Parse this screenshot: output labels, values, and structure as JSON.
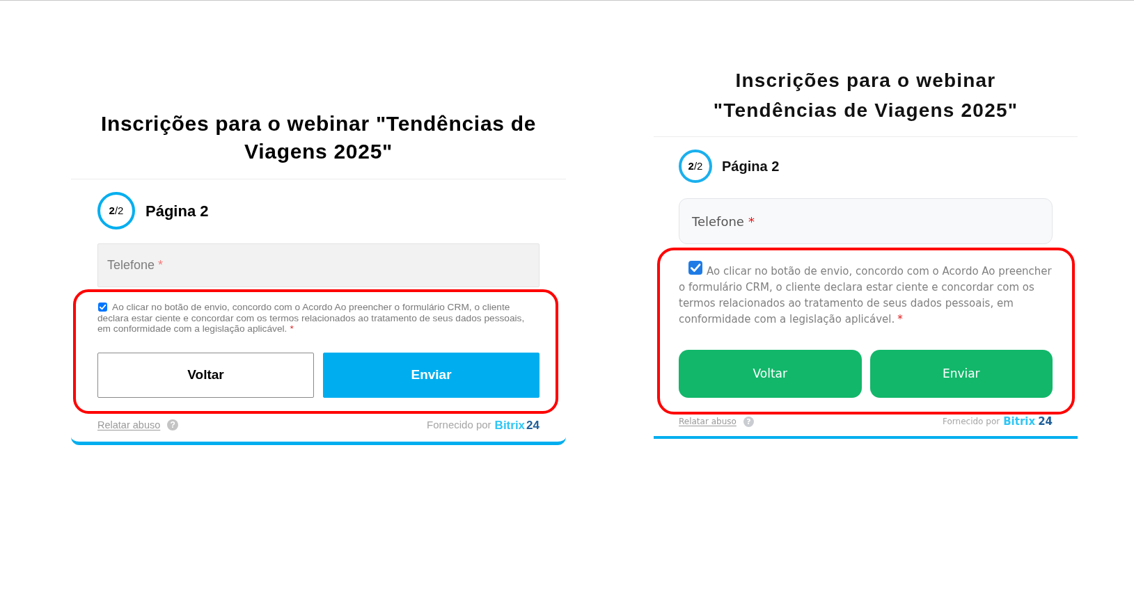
{
  "panels": [
    {
      "kind": "classic",
      "title": "Inscrições para o webinar \"Tendências de Viagens 2025\"",
      "step": "**2**/2",
      "page_title": "Página 2",
      "fields": [
        {
          "placeholder": "Telefone",
          "required_mark": "*"
        }
      ],
      "consent": {
        "checked": true,
        "text": "Ao clicar no botão de envio, concordo com o Acordo Ao preencher o formulário CRM, o cliente declara estar ciente e concordar com os termos relacionados ao tratamento de seus dados pessoais, em conformidade com a legislação aplicável.",
        "required_mark": "*"
      },
      "highlighted": true,
      "buttons": [
        {
          "label": "Voltar",
          "kind": "outline"
        },
        {
          "label": "Enviar",
          "kind": "filled"
        }
      ],
      "footer": {
        "report_link": "Relatar abuso",
        "help_icon": "?",
        "powered_by": "Fornecido por",
        "brand": "Bitrix",
        "brand_number": "24"
      }
    },
    {
      "kind": "modern",
      "title": "Inscrições para o webinar \"Tendências de Viagens 2025\"",
      "step": "**2**/2",
      "page_title": "Página 2",
      "fields": [
        {
          "placeholder": "Telefone",
          "required_mark": "*"
        }
      ],
      "consent": {
        "checked": true,
        "text": "Ao clicar no botão de envio, concordo com o Acordo Ao preencher o formulário CRM, o cliente declara estar ciente e concordar com os termos relacionados ao tratamento de seus dados pessoais, em conformidade com a legislação aplicável.",
        "required_mark": "*"
      },
      "highlighted": true,
      "buttons": [
        {
          "label": "Voltar",
          "kind": "filled"
        },
        {
          "label": "Enviar",
          "kind": "filled"
        }
      ],
      "footer": {
        "report_link": "Relatar abuso",
        "help_icon": "?",
        "powered_by": "Fornecido por",
        "brand": "Bitrix",
        "brand_number": "24"
      }
    }
  ]
}
